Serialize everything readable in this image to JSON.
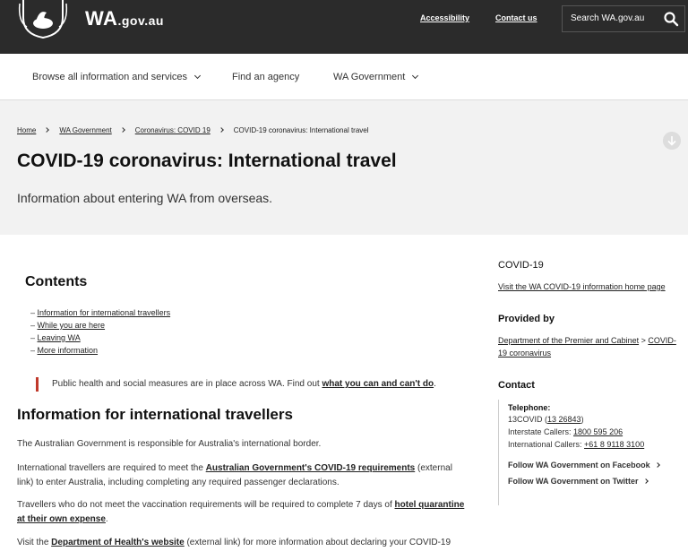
{
  "header": {
    "brand": "WA",
    "brand_suffix": ".gov.au",
    "links": [
      "Accessibility",
      "Contact us"
    ],
    "search_placeholder": "Search WA.gov.au"
  },
  "nav": {
    "items": [
      "Browse all information and services",
      "Find an agency",
      "WA Government"
    ]
  },
  "breadcrumb": [
    "Home",
    "WA Government",
    "Coronavirus: COVID 19",
    "COVID-19 coronavirus: International travel"
  ],
  "page": {
    "title": "COVID-19 coronavirus: International travel",
    "subtitle": "Information about entering WA from overseas."
  },
  "contents": {
    "heading": "Contents",
    "items": [
      "Information for international travellers",
      "While you are here",
      "Leaving WA",
      "More information"
    ]
  },
  "notice": {
    "text": "Public health and social measures are in place across WA. Find out ",
    "link": "what you can and can't do",
    "end": "."
  },
  "section": {
    "heading": "Information for international travellers",
    "p1": "The Australian Government is responsible for Australia's international border.",
    "p2_a": "International travellers are required to meet the ",
    "p2_link": "Australian Government's COVID-19 requirements",
    "p2_b": " (external link) to enter Australia, including completing any required passenger declarations.",
    "p3_a": "Travellers who do not meet the vaccination requirements will be required to complete 7 days of ",
    "p3_link": "hotel quarantine at their own expense",
    "p3_b": ".",
    "p4_a": "Visit the ",
    "p4_link": "Department of Health's website",
    "p4_b": " (external link) for more information about declaring your COVID-19"
  },
  "sidebar": {
    "covid_heading": "COVID-19",
    "covid_link": "Visit the WA COVID-19 information home page",
    "provided_heading": "Provided by",
    "provided_link1": "Department of the Premier and Cabinet",
    "provided_sep": " > ",
    "provided_link2a": "COVID-",
    "provided_link2b": "19 coronavirus",
    "contact_heading": "Contact",
    "telephone_label": "Telephone:",
    "line1_a": "13COVID (",
    "line1_link": "13 26843",
    "line1_b": ")",
    "line2_a": "Interstate Callers: ",
    "line2_link": "1800 595 206",
    "line3_a": "International Callers: ",
    "line3_link": "+61 8 9118 3100",
    "facebook": "Follow WA Government on Facebook",
    "twitter": "Follow WA Government on Twitter"
  }
}
